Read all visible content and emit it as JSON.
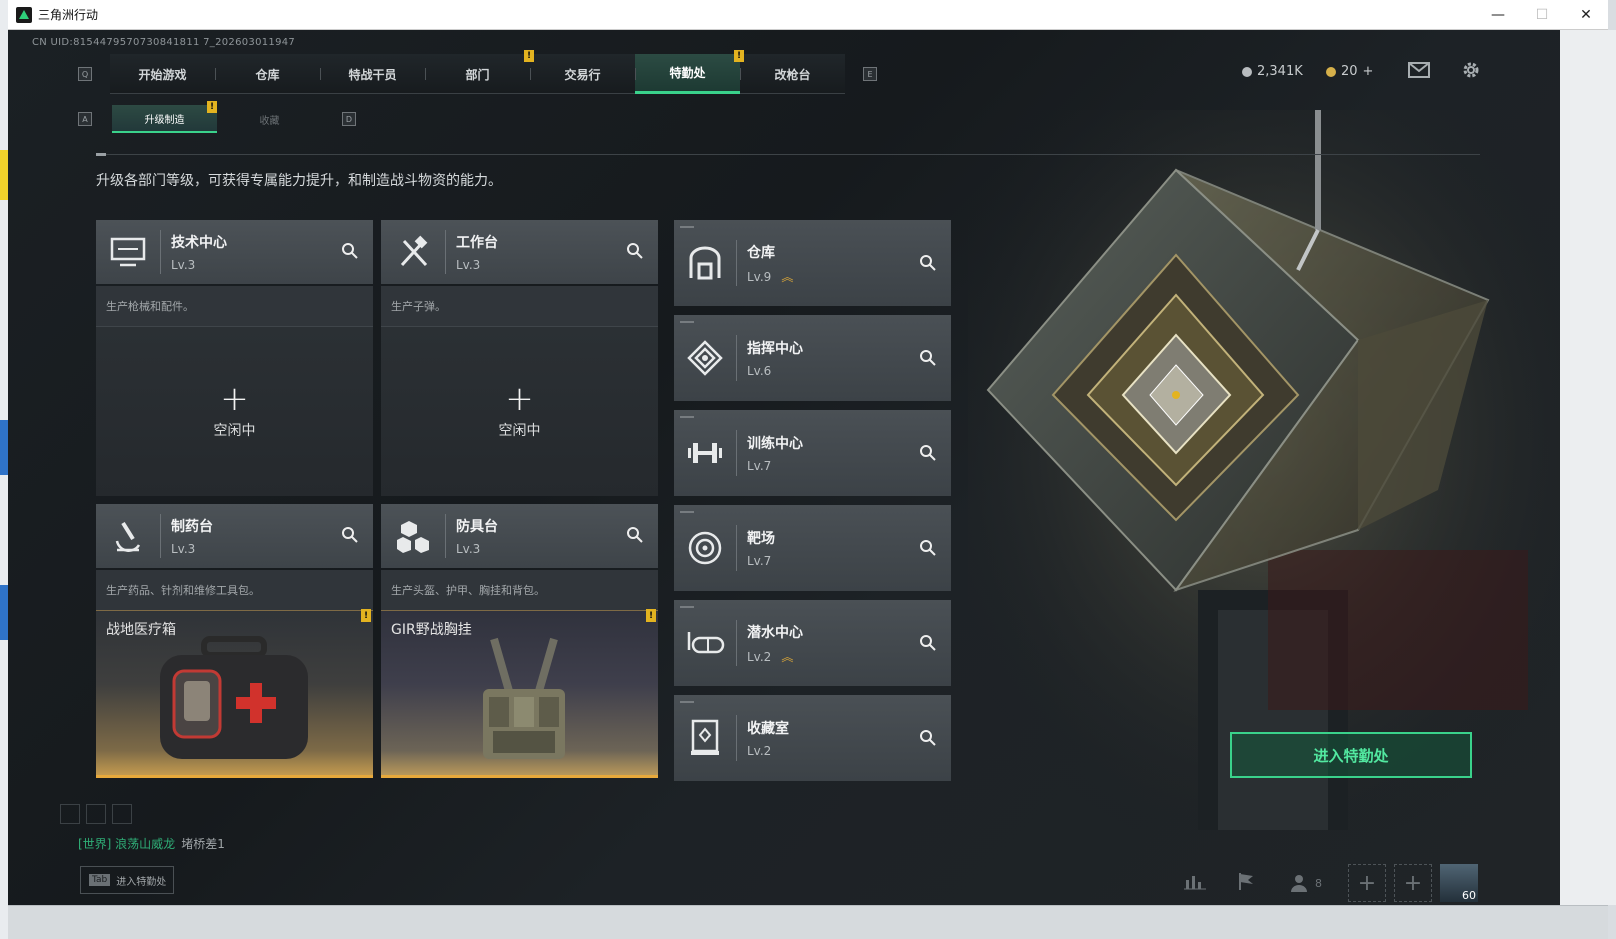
{
  "window": {
    "title": "三角洲行动",
    "controls": {
      "minimize": "—",
      "maximize": "☐",
      "close": "✕"
    }
  },
  "uid": "CN UID:8154479570730841811 7_202603011947",
  "topnav": {
    "left_key": "Q",
    "right_key": "E",
    "items": [
      {
        "label": "开始游戏"
      },
      {
        "label": "仓库"
      },
      {
        "label": "特战干员"
      },
      {
        "label": "部门",
        "alert": "!"
      },
      {
        "label": "交易行"
      },
      {
        "label": "特勤处",
        "alert": "!",
        "active": true
      },
      {
        "label": "改枪台"
      }
    ]
  },
  "currency": {
    "coins": "2,341K",
    "tokens": "20",
    "tokens_plus": "+"
  },
  "subtabs": {
    "left_key": "A",
    "right_key": "D",
    "items": [
      {
        "label": "升级制造",
        "active": true,
        "alert": "!"
      },
      {
        "label": "收藏",
        "active": false
      }
    ]
  },
  "description": "升级各部门等级，可获得专属能力提升，和制造战斗物资的能力。",
  "production_cards": [
    {
      "name": "技术中心",
      "level": "Lv.3",
      "desc": "生产枪械和配件。",
      "state": "idle",
      "plus": "+",
      "idle_label": "空闲中",
      "icon": "monitor-icon"
    },
    {
      "name": "工作台",
      "level": "Lv.3",
      "desc": "生产子弹。",
      "state": "idle",
      "plus": "+",
      "idle_label": "空闲中",
      "icon": "tools-icon"
    },
    {
      "name": "制药台",
      "level": "Lv.3",
      "desc": "生产药品、针剂和维修工具包。",
      "state": "item",
      "item_name": "战地医疗箱",
      "item_alert": "!",
      "icon": "microscope-icon"
    },
    {
      "name": "防具台",
      "level": "Lv.3",
      "desc": "生产头盔、护甲、胸挂和背包。",
      "state": "item",
      "item_name": "GIR野战胸挂",
      "item_alert": "!",
      "icon": "armor-icon"
    }
  ],
  "departments": [
    {
      "name": "仓库",
      "level": "Lv.9",
      "upgradable": true,
      "icon": "warehouse-icon"
    },
    {
      "name": "指挥中心",
      "level": "Lv.6",
      "upgradable": false,
      "icon": "command-icon"
    },
    {
      "name": "训练中心",
      "level": "Lv.7",
      "upgradable": false,
      "icon": "dumbbell-icon"
    },
    {
      "name": "靶场",
      "level": "Lv.7",
      "upgradable": false,
      "icon": "target-icon"
    },
    {
      "name": "潜水中心",
      "level": "Lv.2",
      "upgradable": true,
      "icon": "diving-mask-icon"
    },
    {
      "name": "收藏室",
      "level": "Lv.2",
      "upgradable": false,
      "icon": "collection-icon"
    }
  ],
  "enter_button": "进入特勤处",
  "chat": {
    "channel": "[世界] 浪荡山威龙",
    "message": "堵桥差1"
  },
  "tab_hint": {
    "key": "Tab",
    "label": "进入特勤处"
  },
  "bottom": {
    "friends_count": "8",
    "avatar_level": "60"
  },
  "colors": {
    "accent": "#3ad28b",
    "alert": "#e3b320",
    "gold_rarity": "#e7a93c"
  }
}
